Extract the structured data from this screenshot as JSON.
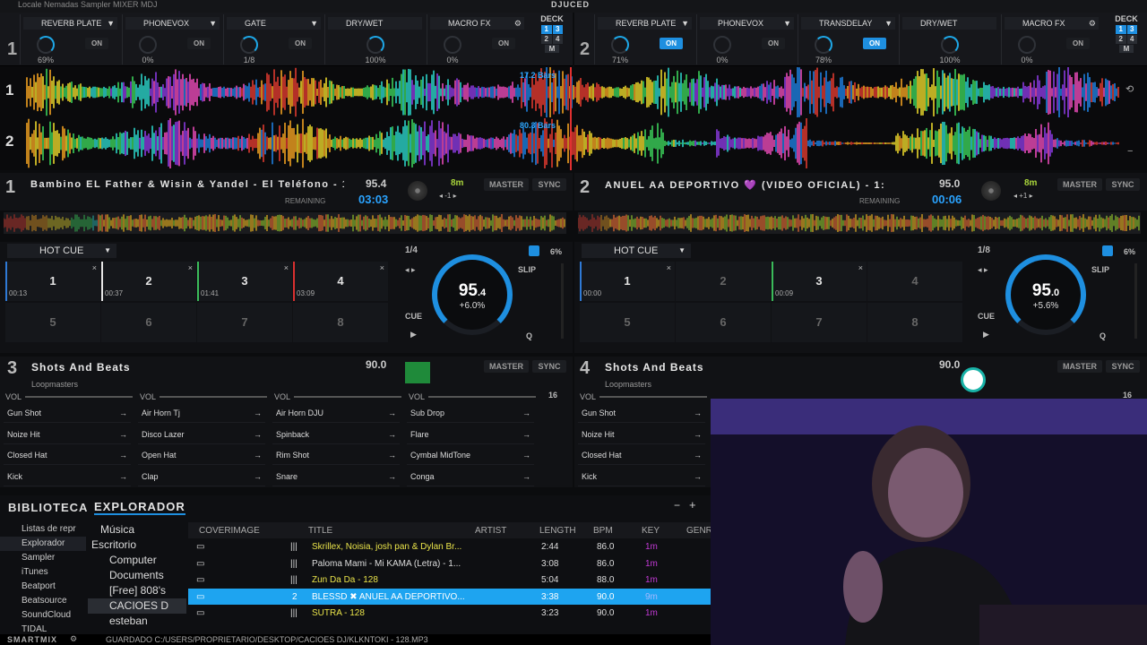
{
  "app": {
    "brand": "DJUCED",
    "topbar_text": "Locale Nemadas    Sampler    MIXER    MDJ"
  },
  "fx": {
    "left": {
      "deck_number": "1",
      "slots": [
        {
          "name": "REVERB PLATE",
          "value": "69%",
          "on": "ON",
          "active": false
        },
        {
          "name": "PHONEVOX",
          "value": "0%",
          "on": "ON",
          "active": false
        },
        {
          "name": "GATE",
          "value": "1/8",
          "on": "ON",
          "active": false
        },
        {
          "name": "DRY/WET",
          "value": "100%"
        },
        {
          "name": "MACRO FX",
          "value": "0%",
          "on": "ON",
          "active": false
        }
      ],
      "deck_label": "DECK",
      "deck_grid": [
        "1",
        "3",
        "2",
        "4"
      ],
      "m_label": "M"
    },
    "right": {
      "deck_number": "2",
      "slots": [
        {
          "name": "REVERB PLATE",
          "value": "71%",
          "on": "ON",
          "active": true
        },
        {
          "name": "PHONEVOX",
          "value": "0%",
          "on": "ON",
          "active": false
        },
        {
          "name": "TRANSDELAY",
          "value": "78%",
          "on": "ON",
          "active": true
        },
        {
          "name": "DRY/WET",
          "value": "100%"
        },
        {
          "name": "MACRO FX",
          "value": "0%",
          "on": "ON",
          "active": false
        }
      ],
      "deck_label": "DECK",
      "deck_grid": [
        "1",
        "3",
        "2",
        "4"
      ],
      "m_label": "M"
    }
  },
  "waveform": {
    "row1": "1",
    "row2": "2",
    "bars1": "17.2 Bars",
    "bars2": "80.3 Bars"
  },
  "deck1": {
    "num": "1",
    "title": "Bambino EL Father & Wisin & Yandel - El Teléfono - 1:",
    "bpm": "95.4",
    "time": "03:03",
    "remaining": "REMAINING",
    "key": "8m",
    "pitch": "-1",
    "master": "MASTER",
    "sync": "SYNC",
    "hotcue": "HOT CUE",
    "loop": "1/4",
    "pct": "6%",
    "slip": "SLIP",
    "cue": "CUE",
    "q": "Q",
    "jog_bpm": "95",
    "jog_dec": ".4",
    "jog_pct": "+6.0%",
    "pads": [
      {
        "n": "1",
        "t": "00:13",
        "x": "×",
        "c": "#2f7ad6"
      },
      {
        "n": "2",
        "t": "00:37",
        "x": "×",
        "c": "#e5e5e5"
      },
      {
        "n": "3",
        "t": "01:41",
        "x": "×",
        "c": "#3bbb5a"
      },
      {
        "n": "4",
        "t": "03:09",
        "x": "×",
        "c": "#d93030"
      },
      {
        "n": "5"
      },
      {
        "n": "6"
      },
      {
        "n": "7"
      },
      {
        "n": "8"
      }
    ]
  },
  "deck2": {
    "num": "2",
    "title": "ANUEL AA  DEPORTIVO  💜  (VIDEO OFICIAL) - 1:",
    "bpm": "95.0",
    "time": "00:06",
    "remaining": "REMAINING",
    "key": "8m",
    "pitch": "+1",
    "master": "MASTER",
    "sync": "SYNC",
    "hotcue": "HOT CUE",
    "loop": "1/8",
    "pct": "6%",
    "slip": "SLIP",
    "cue": "CUE",
    "q": "Q",
    "jog_bpm": "95",
    "jog_dec": ".0",
    "jog_pct": "+5.6%",
    "pads": [
      {
        "n": "1",
        "t": "00:00",
        "x": "×",
        "c": "#2f7ad6"
      },
      {
        "n": "2"
      },
      {
        "n": "3",
        "t": "00:09",
        "x": "×",
        "c": "#3bbb5a"
      },
      {
        "n": "4"
      },
      {
        "n": "5"
      },
      {
        "n": "6"
      },
      {
        "n": "7"
      },
      {
        "n": "8"
      }
    ]
  },
  "deck3": {
    "num": "3",
    "title": "Shots And Beats",
    "sub": "Loopmasters",
    "bpm": "90.0",
    "master": "MASTER",
    "sync": "SYNC",
    "page": "16",
    "vol": "VOL",
    "cols": [
      [
        "Gun Shot",
        "Noize Hit",
        "Closed Hat",
        "Kick"
      ],
      [
        "Air Horn Tj",
        "Disco Lazer",
        "Open Hat",
        "Clap"
      ],
      [
        "Air Horn DJU",
        "Spinback",
        "Rim Shot",
        "Snare"
      ],
      [
        "Sub Drop",
        "Flare",
        "Cymbal MidTone",
        "Conga"
      ]
    ]
  },
  "deck4": {
    "num": "4",
    "title": "Shots And Beats",
    "sub": "Loopmasters",
    "bpm": "90.0",
    "master": "MASTER",
    "sync": "SYNC",
    "page": "16",
    "vol": "VOL",
    "col": [
      "Gun Shot",
      "Noize Hit",
      "Closed Hat",
      "Kick"
    ]
  },
  "browser": {
    "tab1": "BIBLIOTECA",
    "tab2": "EXPLORADOR",
    "left": [
      "Listas de repr",
      "Explorador",
      "Sampler",
      "iTunes",
      "Beatport",
      "Beatsource",
      "SoundCloud",
      "TIDAL"
    ],
    "tree": [
      "Música",
      "Escritorio",
      "Computer",
      "Documents",
      "[Free] 808's",
      "CACIOES D",
      "esteban"
    ],
    "headers": [
      "COVERIMAGE",
      "TITLE",
      "ARTIST",
      "LENGTH",
      "BPM",
      "KEY",
      "GENR"
    ],
    "rows": [
      {
        "title": "Skrillex, Noisia, josh pan & Dylan Br...",
        "length": "2:44",
        "bpm": "86.0",
        "key": "1m",
        "deck": ""
      },
      {
        "title": "Paloma Mami - Mi KAMA (Letra) - 1...",
        "length": "3:08",
        "bpm": "86.0",
        "key": "1m",
        "deck": ""
      },
      {
        "title": "Zun Da Da - 128",
        "length": "5:04",
        "bpm": "88.0",
        "key": "1m",
        "deck": ""
      },
      {
        "title": "BLESSD ✖ ANUEL AA  DEPORTIVO...",
        "length": "3:38",
        "bpm": "90.0",
        "key": "9m",
        "deck": "2"
      },
      {
        "title": "SUTRA - 128",
        "length": "3:23",
        "bpm": "90.0",
        "key": "1m",
        "deck": ""
      }
    ]
  },
  "status": {
    "smartmix": "SMARTMIX",
    "saved": "GUARDADO C:/USERS/PROPRIETARIO/DESKTOP/CACIOES DJ/KLKNTOKI - 128.MP3"
  },
  "colors": {
    "accent": "#1e8fe0",
    "key_green": "#a9d53b",
    "selected_row": "#1ea4f0"
  }
}
